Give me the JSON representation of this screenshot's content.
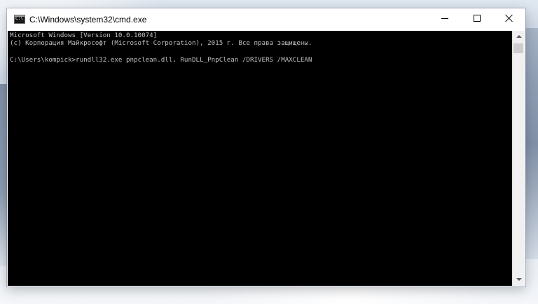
{
  "window": {
    "title": "C:\\Windows\\system32\\cmd.exe",
    "icon": "cmd-console-icon"
  },
  "titlebar_buttons": {
    "minimize_icon": "minimize-icon",
    "maximize_icon": "maximize-icon",
    "close_icon": "close-icon"
  },
  "console": {
    "background": "#000000",
    "text_color": "#c0c0c0",
    "lines": [
      "Microsoft Windows [Version 10.0.10074]",
      "(c) Корпорация Майкрософт (Microsoft Corporation), 2015 г. Все права защищены.",
      "C:\\Users\\kompick>rundll32.exe pnpclean.dll, RunDLL_PnpClean /DRIVERS /MAXCLEAN"
    ]
  },
  "scrollbar": {
    "up_icon": "scroll-up-arrow-icon",
    "down_icon": "scroll-down-arrow-icon"
  }
}
